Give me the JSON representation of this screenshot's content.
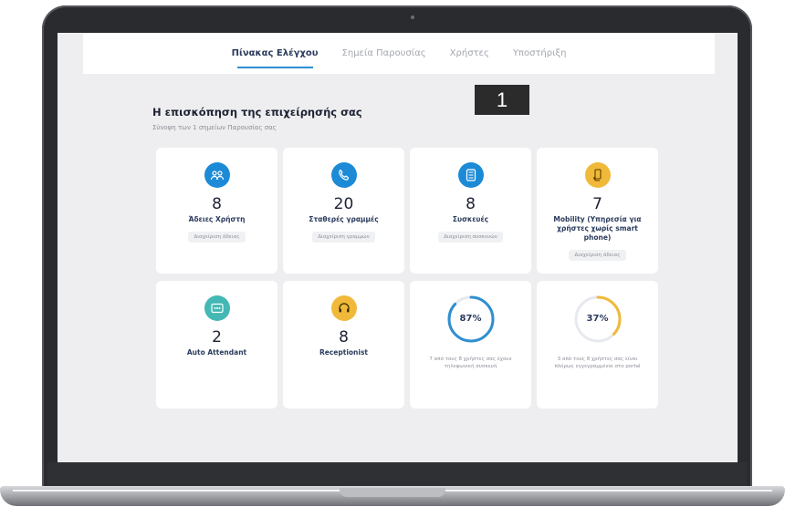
{
  "nav": {
    "items": [
      {
        "label": "Πίνακας Ελέγχου",
        "active": true
      },
      {
        "label": "Σημεία Παρουσίας",
        "active": false
      },
      {
        "label": "Χρήστες",
        "active": false
      },
      {
        "label": "Υποστήριξη",
        "active": false
      }
    ]
  },
  "badge": "1",
  "overview": {
    "title": "Η επισκόπηση της επιχείρησής σας",
    "subtitle": "Σύνοψη των 1 σημείων Παρουσίας σας"
  },
  "cards": {
    "users": {
      "value": "8",
      "label": "Άδειες Χρήστη",
      "chip": "Διαχείριση άδειας",
      "icon": "users-icon"
    },
    "lines": {
      "value": "20",
      "label": "Σταθερές γραμμές",
      "chip": "Διαχείριση γραμμών",
      "icon": "phone-icon"
    },
    "devices": {
      "value": "8",
      "label": "Συσκευές",
      "chip": "Διαχείριση συσκευών",
      "icon": "desk-phone-icon"
    },
    "mobility": {
      "value": "7",
      "label": "Mobility (Υπηρεσία για χρήστες χωρίς smart phone)",
      "chip": "Διαχείριση άδειας",
      "icon": "mobile-hand-icon"
    },
    "auto_attendant": {
      "value": "2",
      "label": "Auto Attendant",
      "icon": "ivr-icon"
    },
    "receptionist": {
      "value": "8",
      "label": "Receptionist",
      "icon": "headset-icon"
    },
    "ring1": {
      "percent_label": "87%",
      "percent": 87,
      "caption": "7 από τους 8 χρήστες σας έχουν τηλεφωνική συσκευή"
    },
    "ring2": {
      "percent_label": "37%",
      "percent": 37,
      "caption": "3 από τους 8 χρήστες σας είναι πλήρως εγγεγραμμένοι στο portal"
    }
  },
  "colors": {
    "accent_blue": "#1c8ad6",
    "accent_yellow": "#f0b93a",
    "accent_teal": "#43b8b4",
    "ring_blue": "#2f8fd0",
    "ring_yellow": "#f0b93a"
  }
}
